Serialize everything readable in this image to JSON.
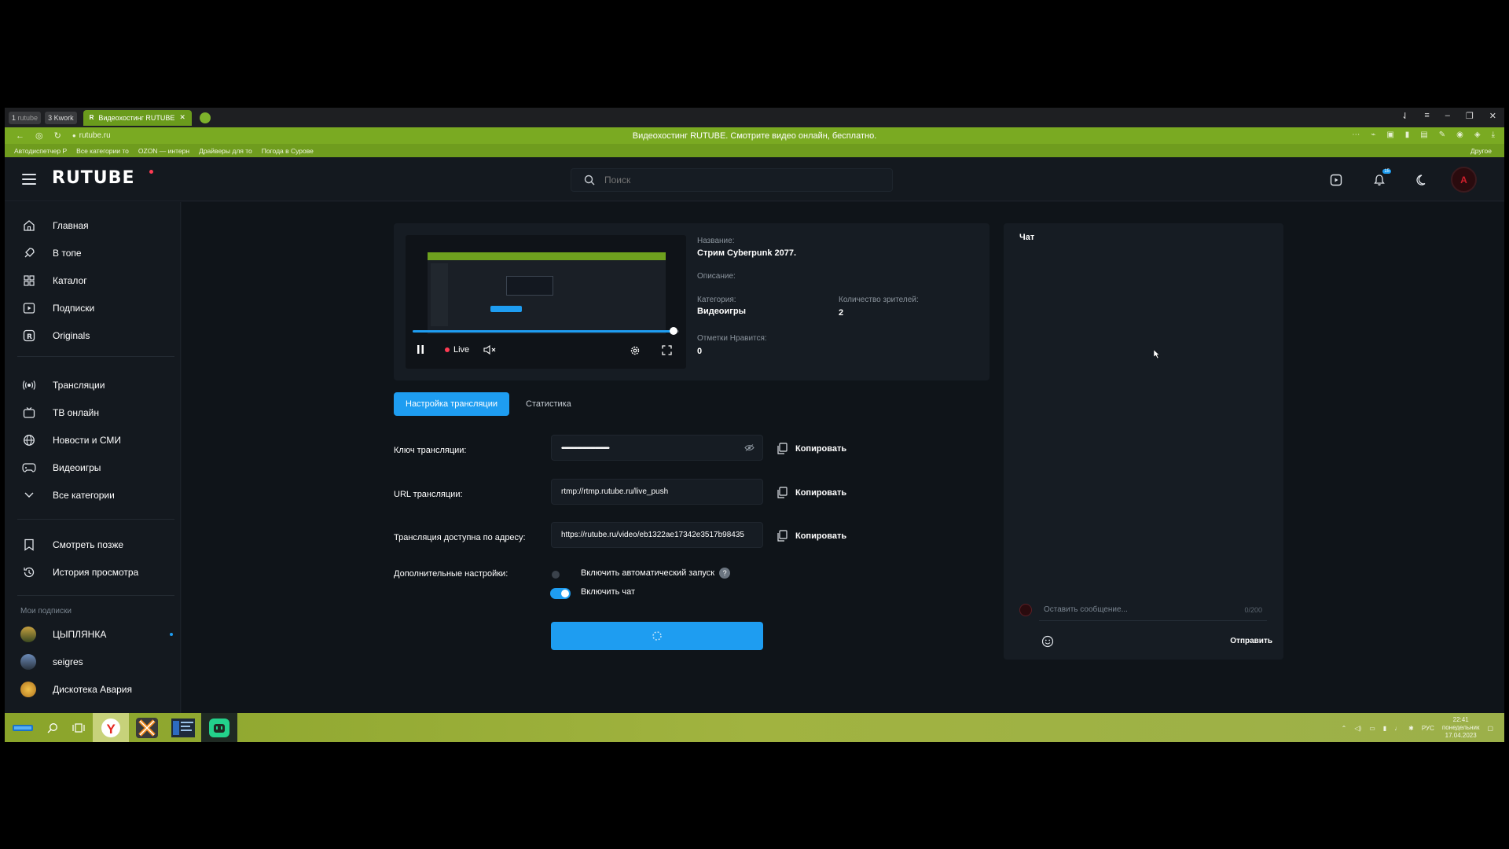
{
  "browser": {
    "tabs": [
      {
        "num": "1",
        "label": "rutube"
      },
      {
        "num": "3",
        "label": "Kwork"
      },
      {
        "label": "Видеохостинг RUTUBE",
        "active": true
      }
    ],
    "url": "rutube.ru",
    "page_title": "Видеохостинг RUTUBE. Смотрите видео онлайн, бесплатно.",
    "bookmarks": [
      "Автодиспетчер Р",
      "Все категории то",
      "OZON — интерн",
      "Драйверы для то",
      "Погода в Сурове"
    ],
    "bookmarks_other": "Другое"
  },
  "header": {
    "logo": "RUTUBE",
    "search_placeholder": "Поиск",
    "notifications_count": "15"
  },
  "sidebar": {
    "main_items": [
      {
        "label": "Главная",
        "icon": "home-icon"
      },
      {
        "label": "В топе",
        "icon": "rocket-icon"
      },
      {
        "label": "Каталог",
        "icon": "grid-icon"
      },
      {
        "label": "Подписки",
        "icon": "subscriptions-icon"
      },
      {
        "label": "Originals",
        "icon": "originals-icon"
      }
    ],
    "cat_items": [
      {
        "label": "Трансляции",
        "icon": "broadcast-icon"
      },
      {
        "label": "ТВ онлайн",
        "icon": "tv-icon"
      },
      {
        "label": "Новости и СМИ",
        "icon": "globe-icon"
      },
      {
        "label": "Видеоигры",
        "icon": "gamepad-icon"
      },
      {
        "label": "Все категории",
        "icon": "chevron-down-icon"
      }
    ],
    "lib_items": [
      {
        "label": "Смотреть позже",
        "icon": "bookmark-icon"
      },
      {
        "label": "История просмотра",
        "icon": "history-icon"
      }
    ],
    "subs_title": "Мои подписки",
    "subs": [
      {
        "label": "ЦЫПЛЯНКА"
      },
      {
        "label": "seigres"
      },
      {
        "label": "Дискотека Авария"
      }
    ]
  },
  "stream": {
    "live_label": "Live",
    "progress": 0.98,
    "title_label": "Название:",
    "title_value": "Стрим Cyberpunk 2077.",
    "desc_label": "Описание:",
    "category_label": "Категория:",
    "category_value": "Видеоигры",
    "viewers_label": "Количество зрителей:",
    "viewers_value": "2",
    "likes_label": "Отметки Нравится:",
    "likes_value": "0"
  },
  "tabs": [
    "Настройка трансляции",
    "Статистика"
  ],
  "form": {
    "key_label": "Ключ трансляции:",
    "key_value": "••••••••••••••••••••••••••••••••••••••••••••••••••••",
    "url_label": "URL трансляции:",
    "url_value": "rtmp://rtmp.rutube.ru/live_push",
    "address_label": "Трансляция доступна по адресу:",
    "address_value": "https://rutube.ru/video/eb1322ae17342e3517b98435",
    "copy_label": "Копировать",
    "extra_label": "Дополнительные настройки:",
    "autostart_label": "Включить автоматический запуск",
    "chat_toggle_label": "Включить чат"
  },
  "chat": {
    "title": "Чат",
    "input_placeholder": "Оставить сообщение...",
    "counter": "0/200",
    "send_label": "Отправить"
  },
  "taskbar": {
    "lang": "РУС",
    "time": "22:41",
    "day": "понедельник",
    "date": "17.04.2023"
  },
  "colors": {
    "accent": "#1e9df1",
    "browser_green": "#7aaa22",
    "bg": "#14191f",
    "live": "#ff3b53"
  }
}
